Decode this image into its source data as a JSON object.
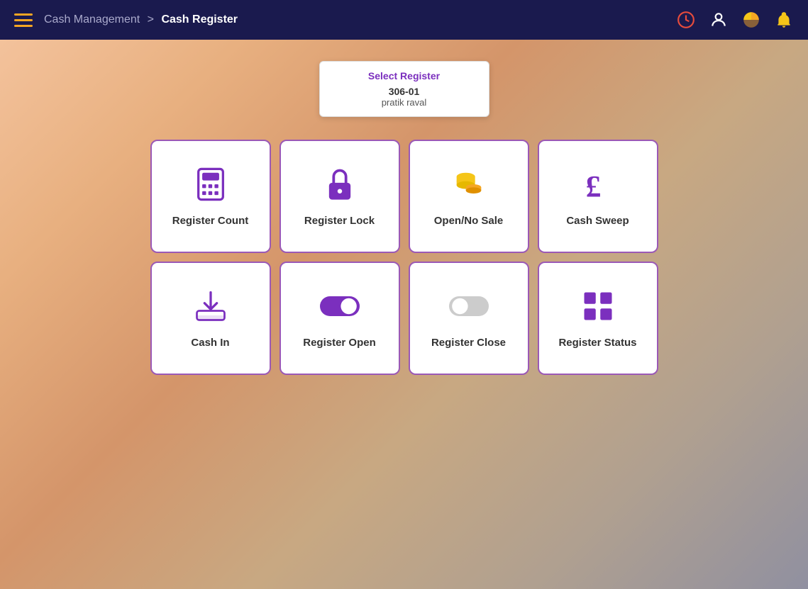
{
  "header": {
    "menu_label": "menu",
    "breadcrumb_parent": "Cash Management",
    "breadcrumb_sep": ">",
    "breadcrumb_current": "Cash Register"
  },
  "icons": {
    "clock": "clock-icon",
    "person": "person-icon",
    "pie": "pie-chart-icon",
    "bell": "bell-icon",
    "hamburger": "hamburger-icon"
  },
  "register_selector": {
    "select_label": "Select Register",
    "register_id": "306-01",
    "user_name": "pratik raval"
  },
  "action_cards": [
    {
      "id": "register-count",
      "label": "Register Count",
      "icon": "calculator"
    },
    {
      "id": "register-lock",
      "label": "Register Lock",
      "icon": "lock"
    },
    {
      "id": "open-no-sale",
      "label": "Open/No Sale",
      "icon": "coins"
    },
    {
      "id": "cash-sweep",
      "label": "Cash Sweep",
      "icon": "pound"
    },
    {
      "id": "cash-in",
      "label": "Cash In",
      "icon": "cash-in"
    },
    {
      "id": "register-open",
      "label": "Register Open",
      "icon": "toggle-on"
    },
    {
      "id": "register-close",
      "label": "Register Close",
      "icon": "toggle-off"
    },
    {
      "id": "register-status",
      "label": "Register Status",
      "icon": "grid"
    }
  ],
  "colors": {
    "accent_purple": "#7b2fbe",
    "header_bg": "#1a1a4e",
    "orange": "#f5a623",
    "yellow": "#f5c518"
  }
}
